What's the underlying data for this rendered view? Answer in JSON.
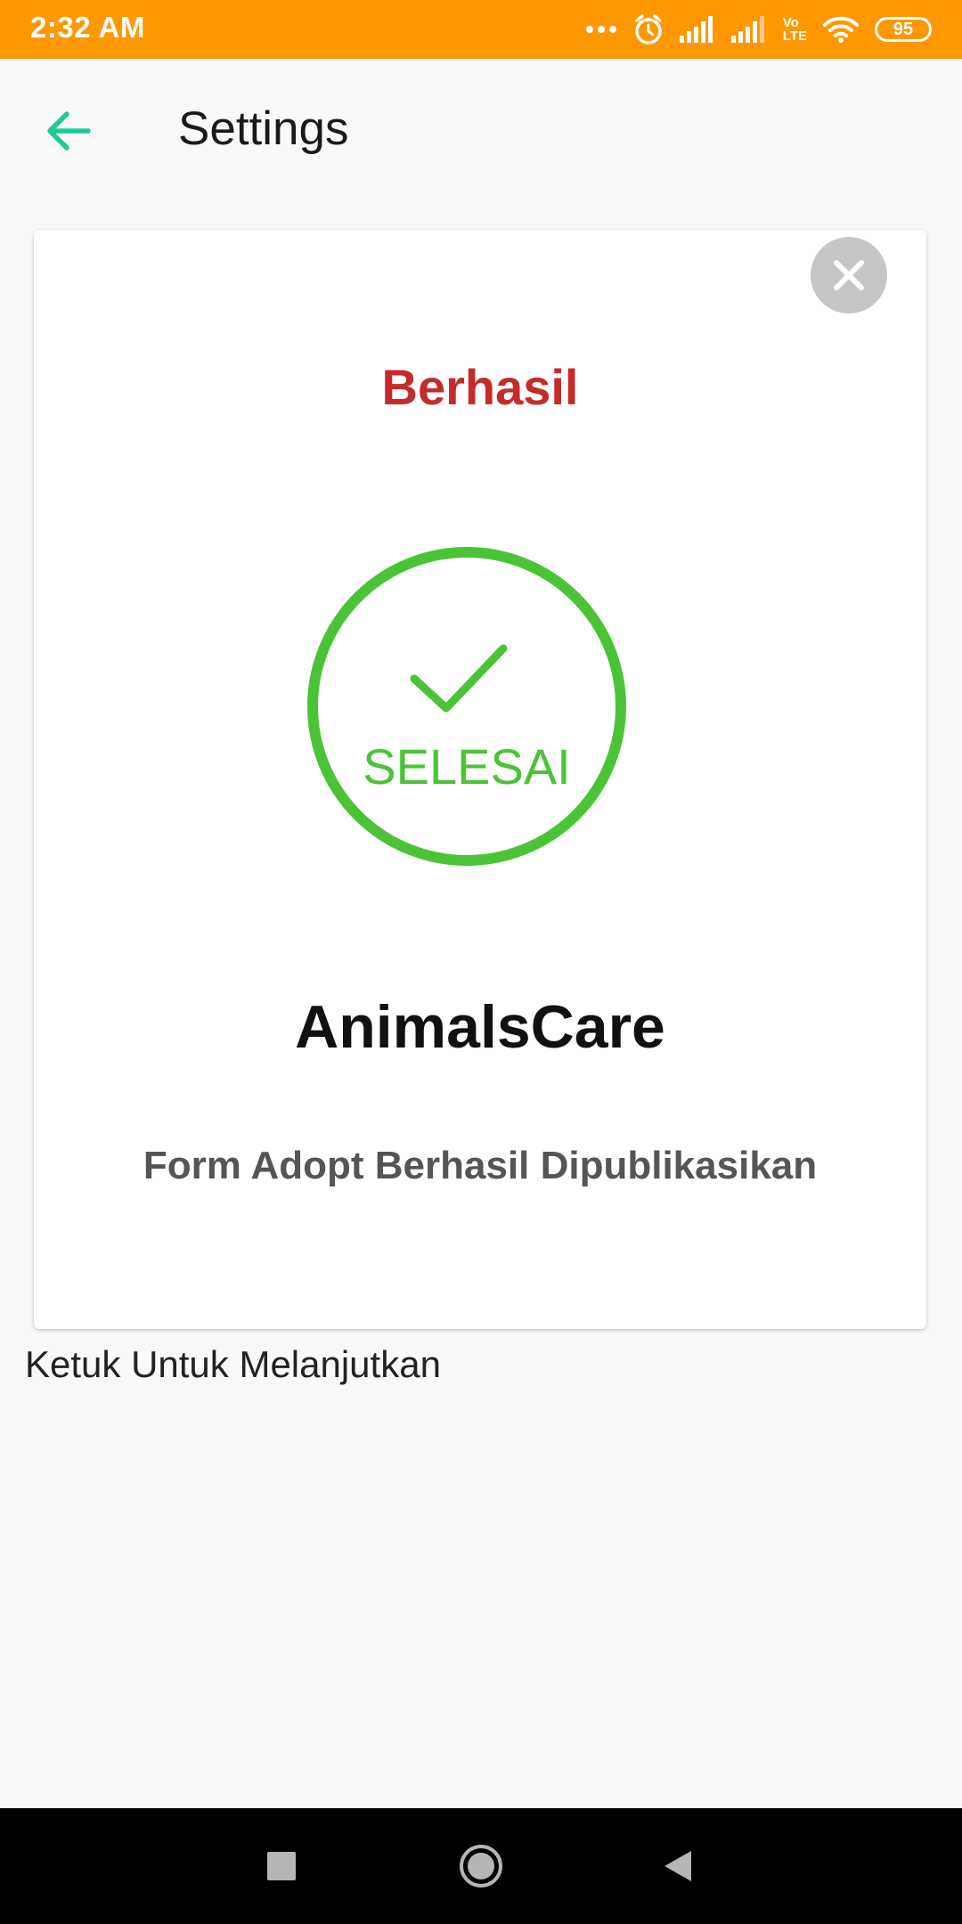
{
  "status_bar": {
    "time": "2:32 AM",
    "battery": "95",
    "network_label_top": "Vo",
    "network_label_bottom": "LTE",
    "icons": [
      "more-dots-icon",
      "alarm-icon",
      "signal-icon",
      "signal-icon",
      "volte-icon",
      "wifi-icon",
      "battery-icon"
    ]
  },
  "app_bar": {
    "back_icon": "arrow-left-icon",
    "title": "Settings"
  },
  "card": {
    "close_icon": "close-icon",
    "heading": "Berhasil",
    "badge_label": "SELESAI",
    "app_name": "AnimalsCare",
    "message": "Form Adopt Berhasil Dipublikasikan"
  },
  "hint": "Ketuk Untuk Melanjutkan",
  "nav_bar": {
    "icons": [
      "recents-icon",
      "home-icon",
      "back-icon"
    ]
  },
  "colors": {
    "status_bar": "#ff9800",
    "accent": "#1fc99a",
    "success_green": "#4ac436",
    "heading_red": "#c62b2b",
    "close_bg": "#c6c6c6",
    "nav_bar": "#000000"
  }
}
